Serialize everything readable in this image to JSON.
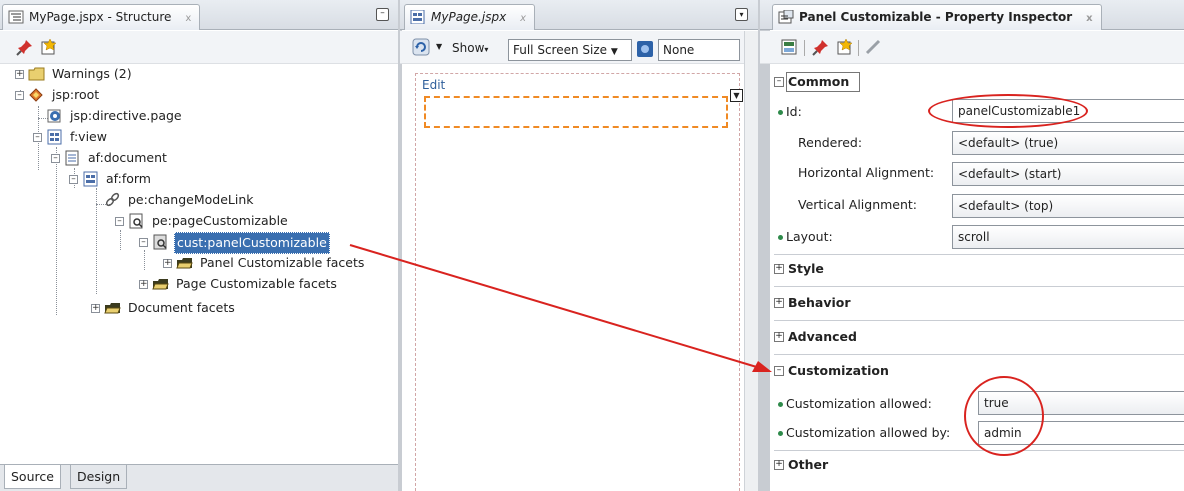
{
  "structure": {
    "tab_title": "MyPage.jspx - Structure",
    "tab_close": "x",
    "tree": [
      {
        "label": "Warnings (2)",
        "icon": "folder-icon"
      },
      {
        "label": "jsp:root",
        "icon": "jsp-root-icon"
      },
      {
        "label": "jsp:directive.page",
        "icon": "directive-icon"
      },
      {
        "label": "f:view",
        "icon": "view-icon"
      },
      {
        "label": "af:document",
        "icon": "document-icon"
      },
      {
        "label": "af:form",
        "icon": "form-icon"
      },
      {
        "label": "pe:changeModeLink",
        "icon": "link-icon"
      },
      {
        "label": "pe:pageCustomizable",
        "icon": "customizable-icon"
      },
      {
        "label": "cust:panelCustomizable",
        "icon": "panel-icon"
      },
      {
        "label": "Panel Customizable facets",
        "icon": "facet-folder-icon"
      },
      {
        "label": "Page Customizable facets",
        "icon": "facet-folder-icon"
      },
      {
        "label": "Document facets",
        "icon": "facet-folder-icon"
      }
    ],
    "bottom_tabs": [
      "Source",
      "Design"
    ]
  },
  "editor": {
    "tab_title": "MyPage.jspx",
    "tab_close": "x",
    "show_label": "Show",
    "size_option": "Full Screen Size",
    "skin_option": "None",
    "edit_label": "Edit"
  },
  "inspector": {
    "tab_title": "Panel Customizable - Property Inspector",
    "tab_close": "x",
    "sections": {
      "common": "Common",
      "style": "Style",
      "behavior": "Behavior",
      "advanced": "Advanced",
      "customization": "Customization",
      "other": "Other"
    },
    "properties": {
      "id_label": "Id:",
      "id_value": "panelCustomizable1",
      "rendered_label": "Rendered:",
      "rendered_value": "<default> (true)",
      "halign_label": "Horizontal Alignment:",
      "halign_value": "<default> (start)",
      "valign_label": "Vertical Alignment:",
      "valign_value": "<default> (top)",
      "layout_label": "Layout:",
      "layout_value": "scroll",
      "cust_allowed_label": "Customization allowed:",
      "cust_allowed_value": "true",
      "cust_by_label": "Customization allowed by:",
      "cust_by_value": "admin"
    }
  },
  "colors": {
    "selection": "#3a6fb0",
    "annotation": "#d9231f",
    "highlight_box": "#f08a24"
  }
}
